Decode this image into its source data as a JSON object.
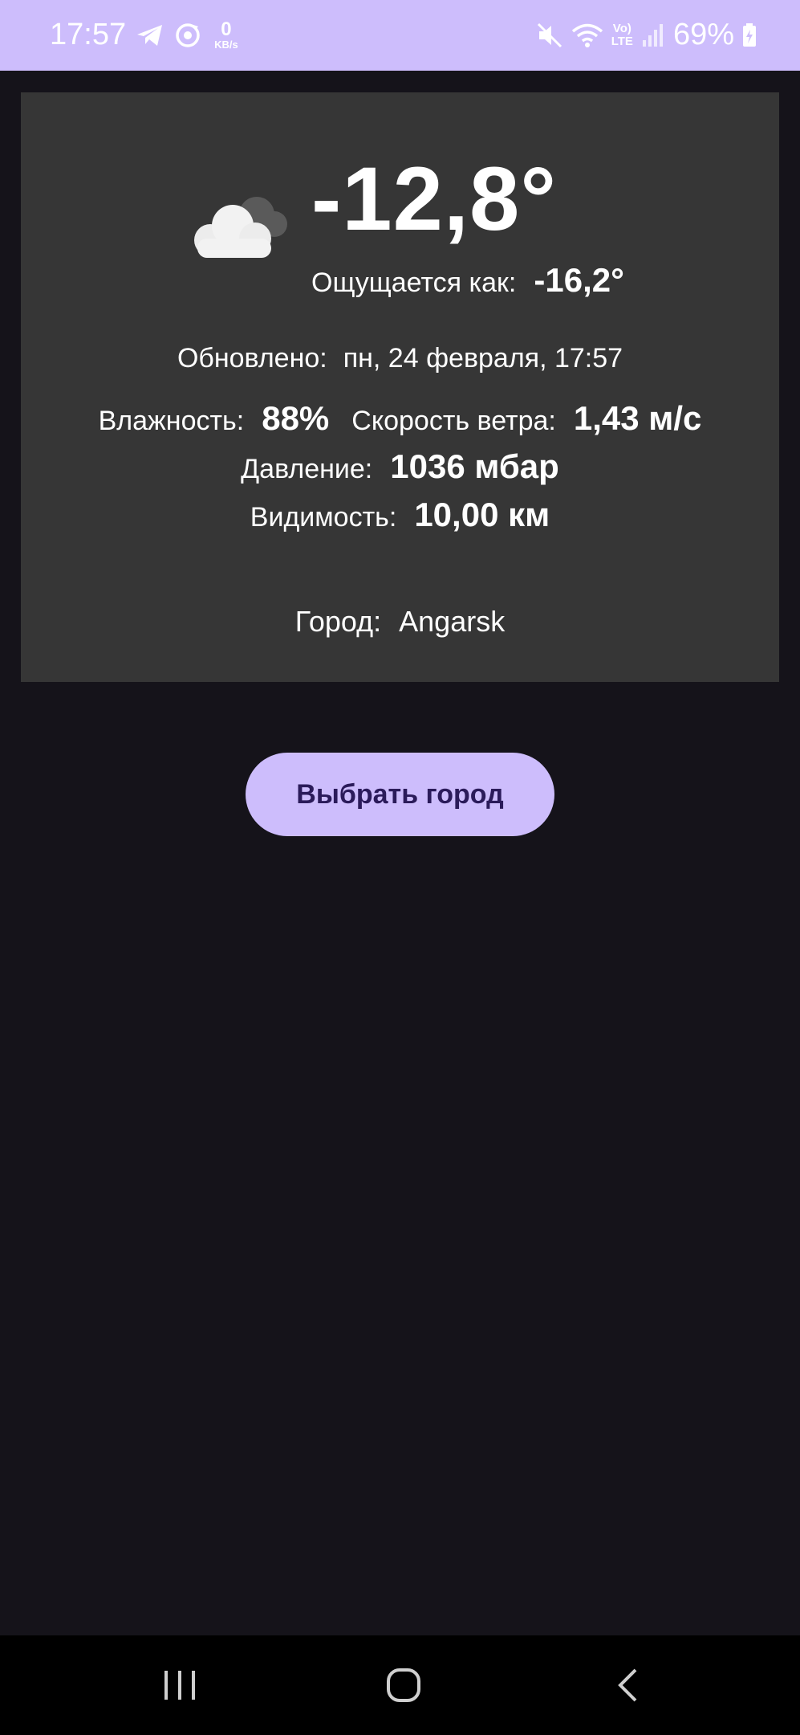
{
  "status_bar": {
    "time": "17:57",
    "kbs_value": "0",
    "kbs_unit": "KB/s",
    "volte_top": "Vo)",
    "volte_bottom": "LTE",
    "battery": "69%",
    "icons": [
      "telegram-icon",
      "sync-icon",
      "mute-icon",
      "wifi-icon",
      "signal-icon",
      "battery-icon"
    ]
  },
  "weather": {
    "temperature": "-12,8°",
    "feels_like_label": "Ощущается как:",
    "feels_like_value": "-16,2°",
    "updated_label": "Обновлено:",
    "updated_value": "пн, 24 февраля, 17:57",
    "humidity_label": "Влажность:",
    "humidity_value": "88%",
    "wind_label": "Скорость ветра:",
    "wind_value": "1,43 м/с",
    "pressure_label": "Давление:",
    "pressure_value": "1036 мбар",
    "visibility_label": "Видимость:",
    "visibility_value": "10,00 км",
    "city_label": "Город:",
    "city_value": "Angarsk",
    "condition_icon": "cloud-icon"
  },
  "actions": {
    "choose_city_label": "Выбрать город"
  },
  "nav": {
    "icons": [
      "recent-apps-icon",
      "home-icon",
      "back-icon"
    ]
  },
  "colors": {
    "accent": "#cdbdfc",
    "background": "#15131a",
    "card": "#363636",
    "button_text": "#2b1b5a"
  }
}
